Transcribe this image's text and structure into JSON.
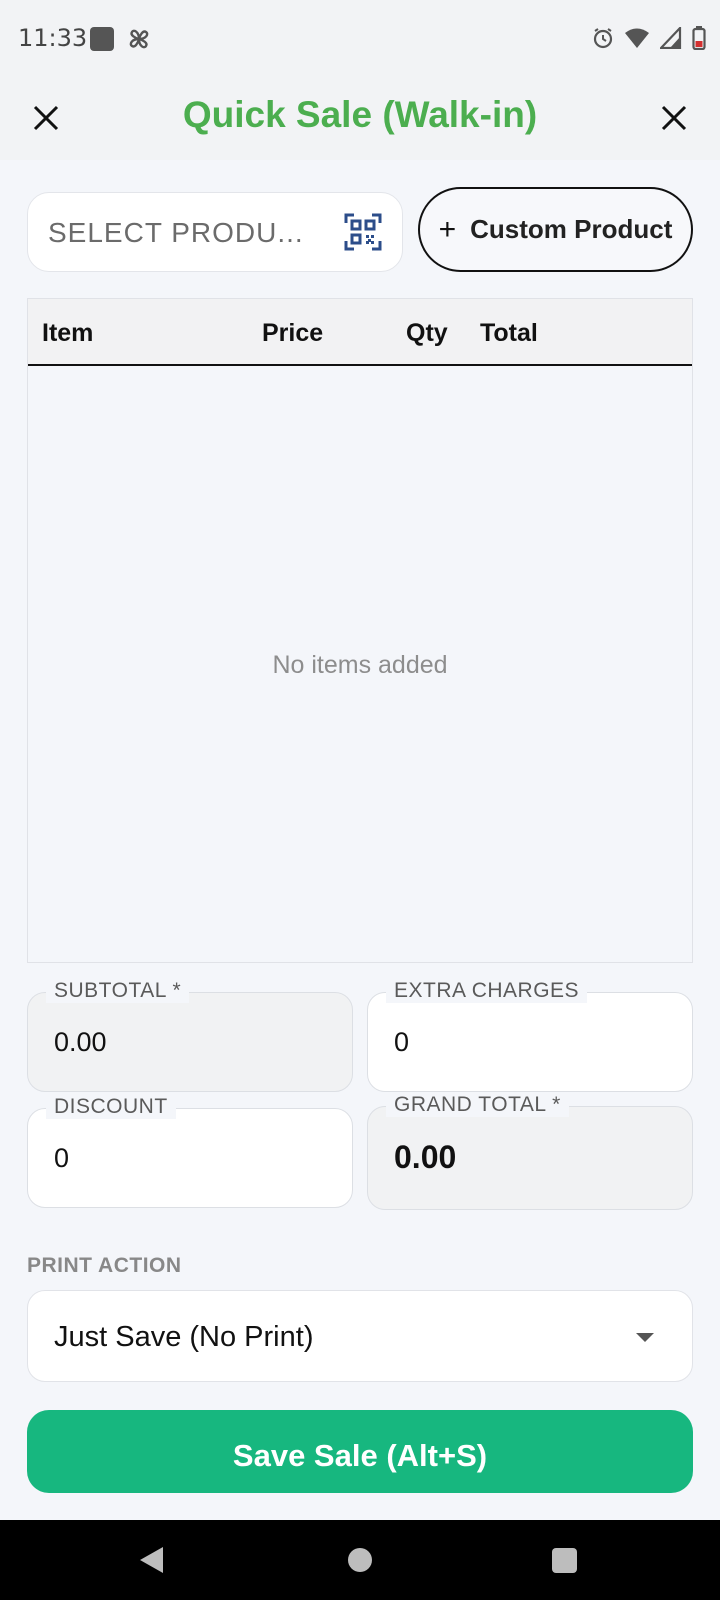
{
  "status_bar": {
    "time": "11:33",
    "icons": [
      "app-square-icon",
      "fan-icon",
      "alarm-icon",
      "wifi-icon",
      "signal-icon",
      "battery-icon"
    ]
  },
  "header": {
    "title": "Quick Sale (Walk-in)",
    "title_color": "#4cae4f"
  },
  "product_search": {
    "placeholder": "SELECT PRODU...",
    "scan_icon": "qr-scan-icon"
  },
  "custom_product": {
    "icon": "+",
    "label": "Custom Product"
  },
  "items_table": {
    "columns": [
      "Item",
      "Price",
      "Qty",
      "Total"
    ],
    "rows": [],
    "empty_message": "No items added"
  },
  "summary": {
    "subtotal": {
      "label": "SUBTOTAL *",
      "value": "0.00"
    },
    "extra_charges": {
      "label": "EXTRA CHARGES",
      "value": "0"
    },
    "discount": {
      "label": "DISCOUNT",
      "value": "0"
    },
    "grand_total": {
      "label": "GRAND TOTAL *",
      "value": "0.00"
    }
  },
  "print_action": {
    "label": "PRINT ACTION",
    "selected": "Just Save (No Print)"
  },
  "save_button": {
    "label": "Save Sale (Alt+S)",
    "color": "#17b77f"
  },
  "nav_bar": {
    "icons": [
      "back-icon",
      "home-icon",
      "recents-icon"
    ]
  }
}
